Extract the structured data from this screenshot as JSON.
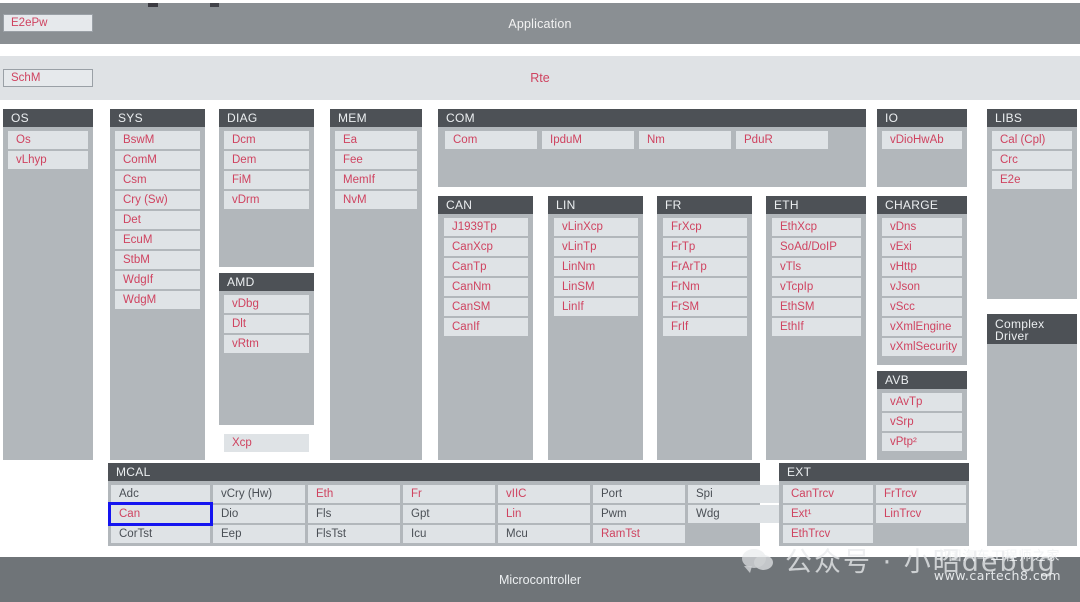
{
  "bands": {
    "application": {
      "title": "Application",
      "chip": "E2ePw"
    },
    "rte": {
      "title": "Rte",
      "chip": "SchM"
    },
    "microcontroller": {
      "title": "Microcontroller"
    }
  },
  "groups": {
    "os": {
      "title": "OS",
      "modules": [
        "Os",
        "vLhyp"
      ]
    },
    "sys": {
      "title": "SYS",
      "modules": [
        "BswM",
        "ComM",
        "Csm",
        "Cry (Sw)",
        "Det",
        "EcuM",
        "StbM",
        "WdgIf",
        "WdgM"
      ]
    },
    "diag": {
      "title": "DIAG",
      "modules": [
        "Dcm",
        "Dem",
        "FiM",
        "vDrm"
      ]
    },
    "amd": {
      "title": "AMD",
      "modules": [
        "vDbg",
        "Dlt",
        "vRtm"
      ]
    },
    "xcp": {
      "label": "Xcp"
    },
    "mem": {
      "title": "MEM",
      "modules": [
        "Ea",
        "Fee",
        "MemIf",
        "NvM"
      ]
    },
    "com": {
      "title": "COM",
      "modules": [
        "Com",
        "IpduM",
        "Nm",
        "PduR"
      ]
    },
    "can": {
      "title": "CAN",
      "modules": [
        "J1939Tp",
        "CanXcp",
        "CanTp",
        "CanNm",
        "CanSM",
        "CanIf"
      ]
    },
    "lin": {
      "title": "LIN",
      "modules": [
        "vLinXcp",
        "vLinTp",
        "LinNm",
        "LinSM",
        "LinIf"
      ]
    },
    "fr": {
      "title": "FR",
      "modules": [
        "FrXcp",
        "FrTp",
        "FrArTp",
        "FrNm",
        "FrSM",
        "FrIf"
      ]
    },
    "eth": {
      "title": "ETH",
      "modules": [
        "EthXcp",
        "SoAd/DoIP",
        "vTls",
        "vTcpIp",
        "EthSM",
        "EthIf"
      ]
    },
    "io": {
      "title": "IO",
      "modules": [
        "vDioHwAb"
      ]
    },
    "charge": {
      "title": "CHARGE",
      "modules": [
        "vDns",
        "vExi",
        "vHttp",
        "vJson",
        "vScc",
        "vXmlEngine",
        "vXmlSecurity"
      ]
    },
    "avb": {
      "title": "AVB",
      "modules": [
        "vAvTp",
        "vSrp",
        "vPtp²"
      ]
    },
    "libs": {
      "title": "LIBS",
      "modules": [
        "Cal (Cpl)",
        "Crc",
        "E2e"
      ]
    },
    "complex_driver": {
      "title": "Complex\nDriver",
      "modules": []
    },
    "mcal": {
      "title": "MCAL",
      "columns": [
        {
          "cells": [
            {
              "label": "Adc",
              "style": "gray"
            },
            {
              "label": "Can",
              "style": "red",
              "selected": true
            },
            {
              "label": "CorTst",
              "style": "gray"
            }
          ]
        },
        {
          "cells": [
            {
              "label": "vCry (Hw)",
              "style": "gray"
            },
            {
              "label": "Dio",
              "style": "gray"
            },
            {
              "label": "Eep",
              "style": "gray"
            }
          ]
        },
        {
          "cells": [
            {
              "label": "Eth",
              "style": "red"
            },
            {
              "label": "Fls",
              "style": "gray"
            },
            {
              "label": "FlsTst",
              "style": "gray"
            }
          ]
        },
        {
          "cells": [
            {
              "label": "Fr",
              "style": "red"
            },
            {
              "label": "Gpt",
              "style": "gray"
            },
            {
              "label": "Icu",
              "style": "gray"
            }
          ]
        },
        {
          "cells": [
            {
              "label": "vIIC",
              "style": "red"
            },
            {
              "label": "Lin",
              "style": "red"
            },
            {
              "label": "Mcu",
              "style": "gray"
            }
          ]
        },
        {
          "cells": [
            {
              "label": "Port",
              "style": "gray"
            },
            {
              "label": "Pwm",
              "style": "gray"
            },
            {
              "label": "RamTst",
              "style": "red"
            }
          ]
        },
        {
          "cells": [
            {
              "label": "Spi",
              "style": "gray"
            },
            {
              "label": "Wdg",
              "style": "gray"
            }
          ]
        }
      ]
    },
    "ext": {
      "title": "EXT",
      "columns": [
        {
          "cells": [
            {
              "label": "CanTrcv",
              "style": "red"
            },
            {
              "label": "Ext¹",
              "style": "red"
            },
            {
              "label": "EthTrcv",
              "style": "red"
            }
          ]
        },
        {
          "cells": [
            {
              "label": "FrTrcv",
              "style": "red"
            },
            {
              "label": "LinTrcv",
              "style": "red"
            }
          ]
        }
      ]
    }
  },
  "watermarks": {
    "wechat": "公众号 · 小昭debug",
    "site_name": "中国汽车工程师之家",
    "site_url": "www.cartech8.com"
  },
  "colors": {
    "module_text": "#cf4360",
    "module_text_gray": "#4a4f55",
    "panel_header": "#4d5156",
    "panel_body": "#b2b7bb",
    "module_chip": "#dfe3e6",
    "application_band": "#8a8f93",
    "rte_band": "#dfe2e5",
    "microcontroller_band": "#6f7478",
    "selection_outline": "#1414f0"
  }
}
